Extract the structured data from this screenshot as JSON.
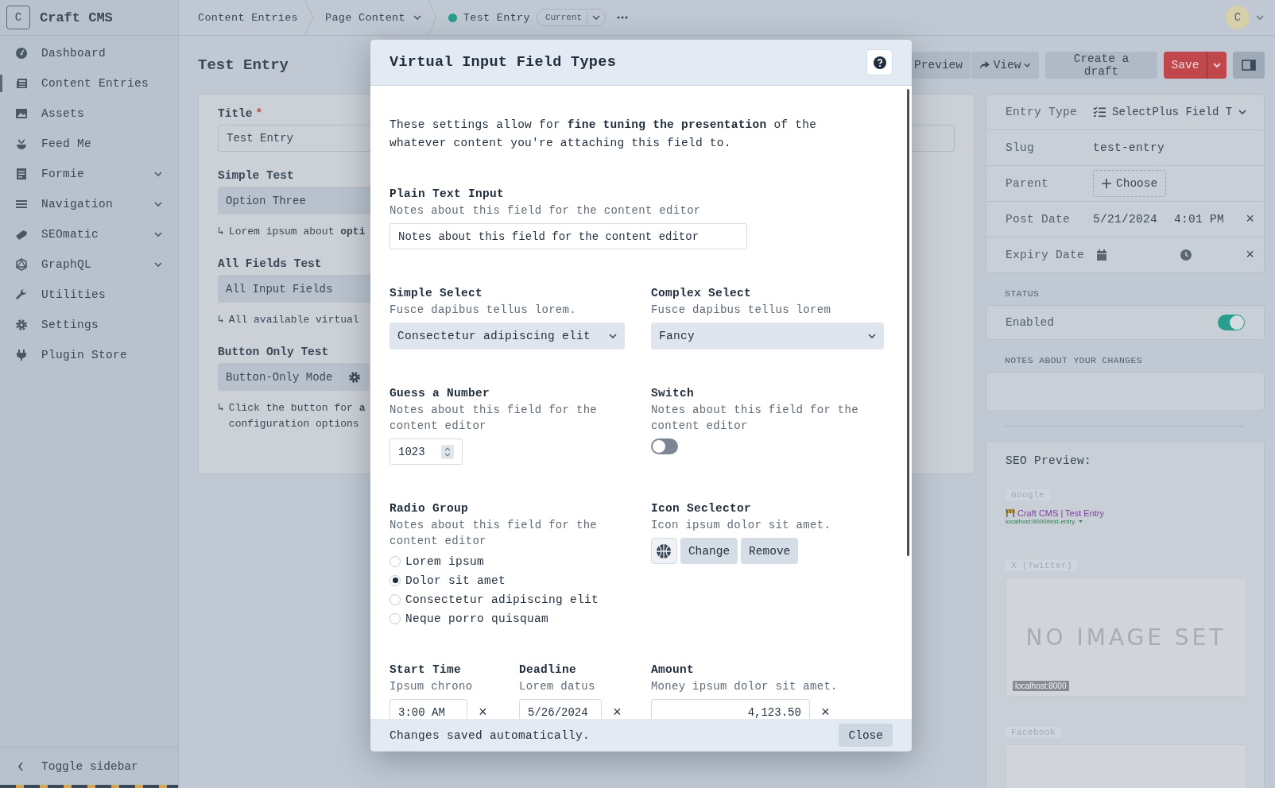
{
  "sidebar": {
    "logo_letter": "C",
    "site_name": "Craft CMS",
    "items": [
      {
        "label": "Dashboard",
        "selected": false,
        "has_submenu": false
      },
      {
        "label": "Content Entries",
        "selected": true,
        "has_submenu": false
      },
      {
        "label": "Assets",
        "selected": false,
        "has_submenu": false
      },
      {
        "label": "Feed Me",
        "selected": false,
        "has_submenu": false
      },
      {
        "label": "Formie",
        "selected": false,
        "has_submenu": true
      },
      {
        "label": "Navigation",
        "selected": false,
        "has_submenu": true
      },
      {
        "label": "SEOmatic",
        "selected": false,
        "has_submenu": true
      },
      {
        "label": "GraphQL",
        "selected": false,
        "has_submenu": true
      },
      {
        "label": "Utilities",
        "selected": false,
        "has_submenu": false
      },
      {
        "label": "Settings",
        "selected": false,
        "has_submenu": false
      },
      {
        "label": "Plugin Store",
        "selected": false,
        "has_submenu": false
      }
    ],
    "toggle": "Toggle sidebar"
  },
  "breadcrumbs": {
    "items": [
      {
        "label": "Content Entries",
        "has_menu": false
      },
      {
        "label": "Page Content",
        "has_menu": true
      }
    ],
    "entry": "Test Entry",
    "revision": "Current"
  },
  "user": {
    "initial": "C"
  },
  "page_title": "Test Entry",
  "required_marker": "*",
  "toolbar": {
    "preview": "Preview",
    "view": "View",
    "draft": "Create a draft",
    "save": "Save"
  },
  "main_fields": [
    {
      "label": "Title",
      "required": true,
      "kind": "text",
      "value": "Test Entry"
    },
    {
      "label": "Simple Test",
      "required": false,
      "kind": "select",
      "value": "Option Three",
      "hint_marker": "↳",
      "hint": "Lorem ipsum about **opti**"
    },
    {
      "label": "All Fields Test",
      "required": false,
      "kind": "select",
      "value": "All Input Fields",
      "hint_marker": "↳",
      "hint": "All available virtual"
    },
    {
      "label": "Button Only Test",
      "required": false,
      "kind": "button",
      "value": "Button-Only Mode",
      "hint_marker": "↳",
      "hint": "Click the button for **a**\nconfiguration options"
    }
  ],
  "modal": {
    "title": "Virtual Input Field Types",
    "intro": "These settings allow for **fine tuning the presentation** of the whatever content you're attaching this field to.",
    "fields": [
      {
        "kind": "text",
        "label": "Plain Text Input",
        "note": "Notes about this field for the content editor",
        "value": "Notes about this field for the content editor"
      },
      {
        "kind": "select",
        "label": "Simple Select",
        "note": "Fusce dapibus tellus lorem.",
        "value": "Consectetur adipiscing elit"
      },
      {
        "kind": "select",
        "label": "Complex Select",
        "note": "Fusce dapibus tellus lorem",
        "value": "Fancy"
      },
      {
        "kind": "number",
        "label": "Guess a Number",
        "note": "Notes about this field for the content editor",
        "value": "1023"
      },
      {
        "kind": "switch",
        "label": "Switch",
        "note": "Notes about this field for the content editor",
        "on": false
      },
      {
        "kind": "radio",
        "label": "Radio Group",
        "note": "Notes about this field for the content editor",
        "options": [
          {
            "label": "Lorem ipsum",
            "selected": false
          },
          {
            "label": "Dolor sit amet",
            "selected": true
          },
          {
            "label": "Consectetur adipiscing elit",
            "selected": false
          },
          {
            "label": "Neque porro quisquam",
            "selected": false
          }
        ]
      },
      {
        "kind": "icon",
        "label": "Icon Seclector",
        "note": "Icon ipsum dolor sit amet.",
        "buttons": [
          "Change",
          "Remove"
        ]
      },
      {
        "kind": "time",
        "label": "Start Time",
        "note": "Ipsum chrono",
        "value": "3:00 AM",
        "clear": "×"
      },
      {
        "kind": "date",
        "label": "Deadline",
        "note": "Lorem datus",
        "value": "5/26/2024",
        "clear": "×"
      },
      {
        "kind": "money",
        "label": "Amount",
        "note": "Money ipsum dolor sit amet.",
        "value": "4,123.50",
        "clear": "×"
      }
    ],
    "footer_note": "Changes saved automatically.",
    "close": "Close"
  },
  "meta": [
    {
      "kind": "type",
      "label": "Entry Type",
      "value": "SelectPlus Field T"
    },
    {
      "kind": "text",
      "label": "Slug",
      "value": "test-entry"
    },
    {
      "kind": "choose",
      "label": "Parent",
      "value": "Choose"
    },
    {
      "kind": "datetime",
      "label": "Post Date",
      "date": "5/21/2024",
      "time": "4:01 PM",
      "clear": "×"
    },
    {
      "kind": "empty-datetime",
      "label": "Expiry Date",
      "clear": "×"
    }
  ],
  "status": {
    "heading": "STATUS",
    "label": "Enabled",
    "on": true
  },
  "notes": {
    "heading": "NOTES ABOUT YOUR CHANGES"
  },
  "seo": {
    "title": "SEO Preview:",
    "google": {
      "tag": "Google",
      "title": "Craft CMS | Test Entry",
      "url": "localhost:8000/test-entry"
    },
    "twitter": {
      "tag": "X (Twitter)",
      "image_text": "NO IMAGE SET",
      "domain": "localhost:8000"
    },
    "facebook": {
      "tag": "Facebook"
    }
  }
}
